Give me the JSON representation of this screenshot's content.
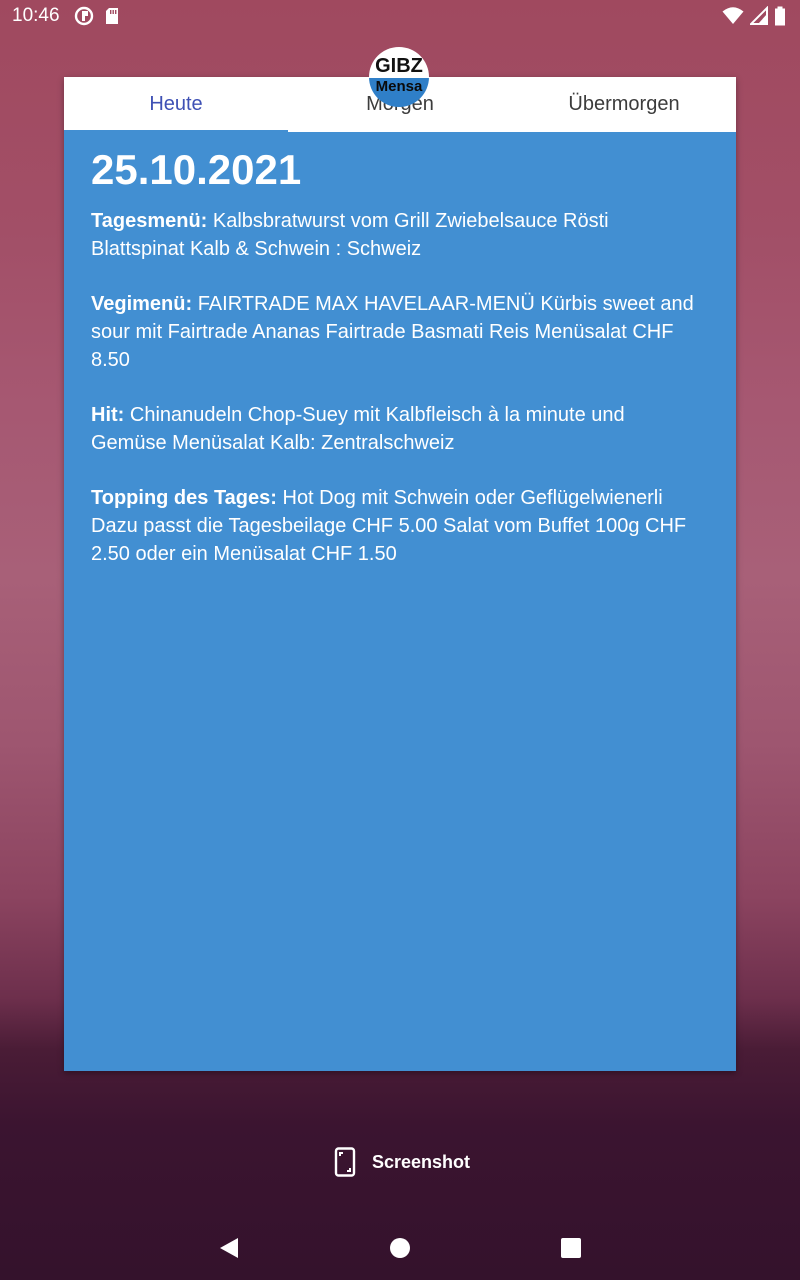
{
  "status_bar": {
    "time": "10:46"
  },
  "logo": {
    "top_text": "GIBZ",
    "bottom_text": "Mensa"
  },
  "tabs": [
    {
      "label": "Heute",
      "active": true
    },
    {
      "label": "Morgen",
      "active": false
    },
    {
      "label": "Übermorgen",
      "active": false
    }
  ],
  "content": {
    "date": "25.10.2021",
    "menus": [
      {
        "label": "Tagesmenü:",
        "text": " Kalbsbratwurst vom Grill Zwiebelsauce Rösti Blattspinat Kalb & Schwein : Schweiz"
      },
      {
        "label": "Vegimenü:",
        "text": " FAIRTRADE MAX HAVELAAR-MENÜ Kürbis sweet and sour mit Fairtrade Ananas Fairtrade Basmati Reis Menüsalat CHF 8.50"
      },
      {
        "label": "Hit:",
        "text": " Chinanudeln Chop-Suey mit Kalbfleisch à la minute und Gemüse Menüsalat Kalb: Zentralschweiz"
      },
      {
        "label": "Topping des Tages:",
        "text": " Hot Dog mit Schwein oder Geflügelwienerli Dazu passt die Tagesbeilage CHF 5.00 Salat vom Buffet 100g CHF 2.50 oder ein Menüsalat CHF 1.50"
      }
    ]
  },
  "screenshot_chip": {
    "label": "Screenshot"
  },
  "colors": {
    "card_background": "#428fd2",
    "active_tab": "#3f51b5"
  }
}
